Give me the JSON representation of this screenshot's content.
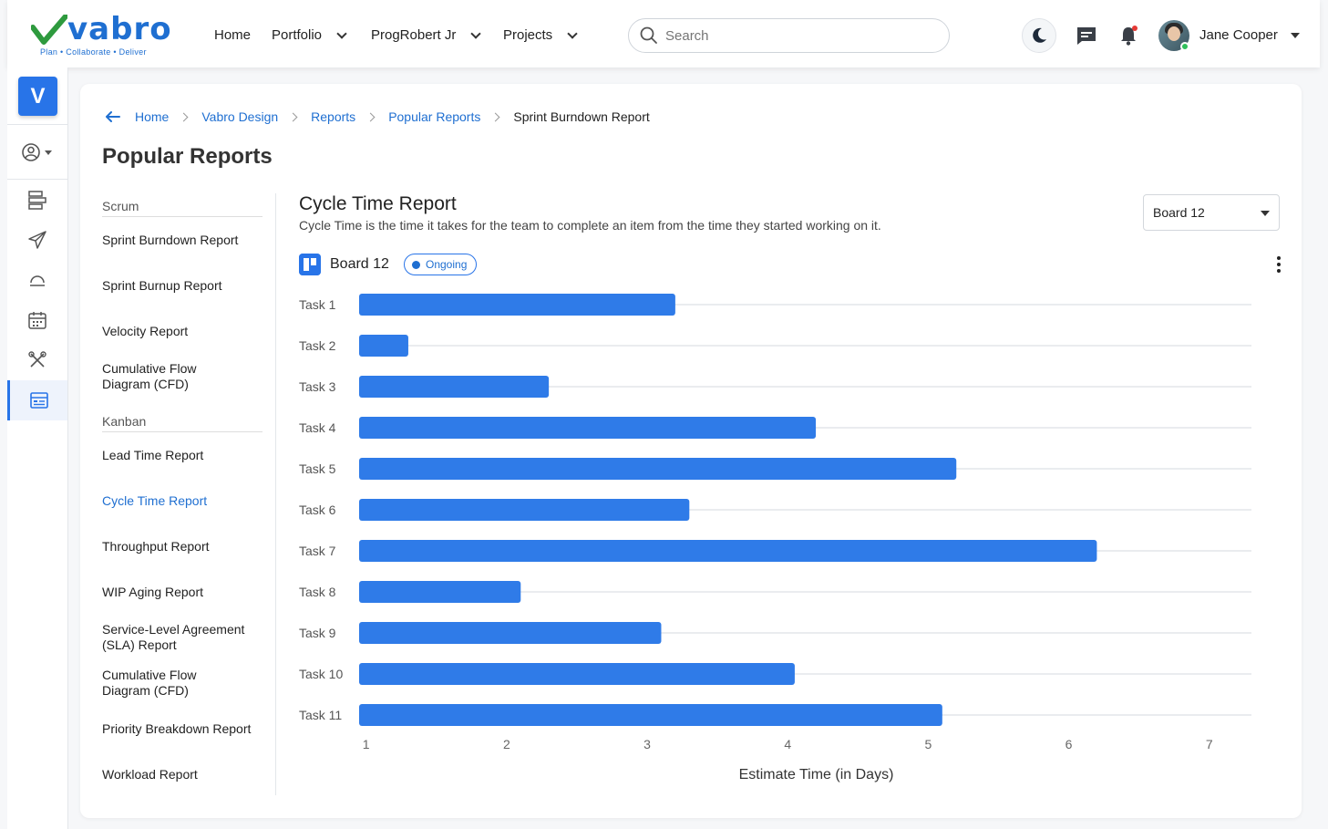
{
  "brand": {
    "name": "vabro",
    "tagline": "Plan • Collaborate • Deliver",
    "initial": "V"
  },
  "topnav": {
    "items": [
      "Home",
      "Portfolio",
      "ProgRobert Jr",
      "Projects"
    ],
    "search_placeholder": "Search",
    "user_name": "Jane Cooper"
  },
  "breadcrumb": [
    "Home",
    "Vabro Design",
    "Reports",
    "Popular Reports",
    "Sprint Burndown Report"
  ],
  "page_title": "Popular Reports",
  "sidebar": {
    "scrum_label": "Scrum",
    "scrum_items": [
      "Sprint Burndown Report",
      "Sprint Burnup Report",
      "Velocity Report",
      "Cumulative Flow Diagram (CFD)"
    ],
    "kanban_label": "Kanban",
    "kanban_items": [
      "Lead Time Report",
      "Cycle Time Report",
      "Throughput Report",
      "WIP Aging Report",
      "Service-Level Agreement (SLA) Report",
      "Cumulative Flow Diagram (CFD)",
      "Priority Breakdown Report",
      "Workload Report"
    ],
    "active_item": "Cycle Time Report"
  },
  "report": {
    "title": "Cycle Time Report",
    "description": "Cycle Time is the time it takes for the team to complete an item from the time they started working on it.",
    "board_select": "Board 12",
    "board_name": "Board 12",
    "status": "Ongoing"
  },
  "colors": {
    "accent": "#2874e8",
    "bar": "#2f7be8",
    "online": "#2fbf5b",
    "notification": "#e53935"
  },
  "chart_data": {
    "type": "bar",
    "orientation": "horizontal",
    "categories": [
      "Task 1",
      "Task 2",
      "Task 3",
      "Task 4",
      "Task 5",
      "Task 6",
      "Task 7",
      "Task 8",
      "Task 9",
      "Task 10",
      "Task 11"
    ],
    "values": [
      3.2,
      1.3,
      2.3,
      4.2,
      5.2,
      3.3,
      6.2,
      2.1,
      3.1,
      4.05,
      5.1
    ],
    "x_ticks": [
      1,
      2,
      3,
      4,
      5,
      6,
      7
    ],
    "xlim": [
      0.95,
      7.3
    ],
    "xlabel": "Estimate Time (in Days)",
    "grid": true
  }
}
